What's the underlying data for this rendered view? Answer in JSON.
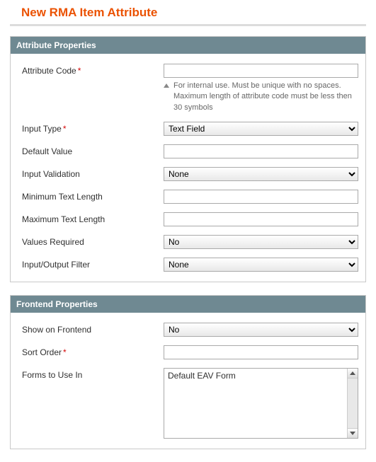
{
  "page": {
    "title": "New RMA Item Attribute"
  },
  "sections": {
    "attr": {
      "header": "Attribute Properties",
      "fields": {
        "code": {
          "label": "Attribute Code",
          "required": true,
          "value": "",
          "helper": "For internal use. Must be unique with no spaces. Maximum length of attribute code must be less then 30 symbols"
        },
        "input_type": {
          "label": "Input Type",
          "required": true,
          "value": "Text Field"
        },
        "default_value": {
          "label": "Default Value",
          "value": ""
        },
        "input_validation": {
          "label": "Input Validation",
          "value": "None"
        },
        "min_len": {
          "label": "Minimum Text Length",
          "value": ""
        },
        "max_len": {
          "label": "Maximum Text Length",
          "value": ""
        },
        "values_required": {
          "label": "Values Required",
          "value": "No"
        },
        "io_filter": {
          "label": "Input/Output Filter",
          "value": "None"
        }
      }
    },
    "frontend": {
      "header": "Frontend Properties",
      "fields": {
        "show_frontend": {
          "label": "Show on Frontend",
          "value": "No"
        },
        "sort_order": {
          "label": "Sort Order",
          "required": true,
          "value": ""
        },
        "forms": {
          "label": "Forms to Use In",
          "options": [
            "Default EAV Form"
          ]
        }
      }
    }
  }
}
